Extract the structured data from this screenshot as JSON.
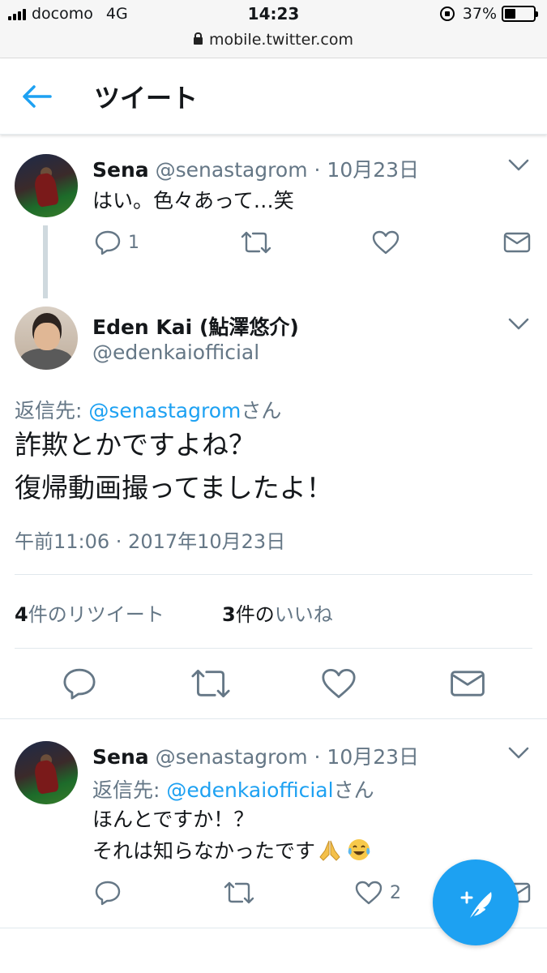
{
  "status_bar": {
    "carrier": "docomo",
    "network": "4G",
    "time": "14:23",
    "battery": "37%",
    "battery_level": 0.37,
    "url": "mobile.twitter.com"
  },
  "header": {
    "title": "ツイート"
  },
  "tweet1": {
    "name": "Sena",
    "handle": "@senastagrom",
    "sep": "·",
    "date": "10月23日",
    "text": "はい。色々あって…笑",
    "reply_count": "1"
  },
  "main_tweet": {
    "name": "Eden Kai (鮎澤悠介)",
    "handle": "@edenkaiofficial",
    "reply_prefix": "返信先: ",
    "reply_to": "@senastagrom",
    "reply_suffix": "さん",
    "text_line1": "詐欺とかですよね？",
    "text_line2": "復帰動画撮ってましたよ！",
    "timestamp": "午前11:06 · 2017年10月23日",
    "retweet_count": "4",
    "retweet_label": "件のリツイート",
    "like_count": "3",
    "like_label_part1": "件の",
    "like_label_part2": "いいね"
  },
  "tweet3": {
    "name": "Sena",
    "handle": "@senastagrom",
    "sep": "·",
    "date": "10月23日",
    "reply_prefix": "返信先: ",
    "reply_to": "@edenkaiofficial",
    "reply_suffix": "さん",
    "text_line1": "ほんとですか！？",
    "text_line2": "それは知らなかったです",
    "like_count": "2"
  },
  "colors": {
    "accent": "#1da1f2",
    "muted": "#657786",
    "text": "#14171a"
  }
}
